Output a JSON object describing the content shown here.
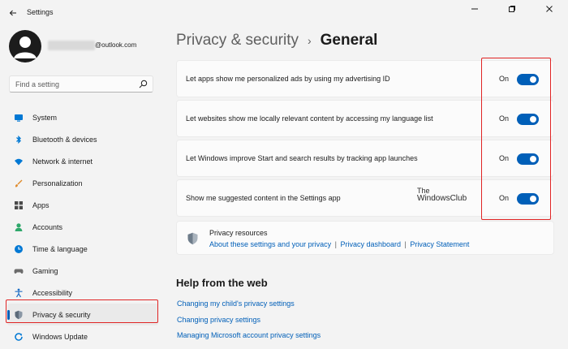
{
  "app": {
    "title": "Settings"
  },
  "profile": {
    "email": "@outlook.com"
  },
  "search": {
    "placeholder": "Find a setting"
  },
  "sidebar": {
    "items": [
      {
        "label": "System",
        "icon": "monitor-icon",
        "color": "#0078d4"
      },
      {
        "label": "Bluetooth & devices",
        "icon": "bluetooth-icon",
        "color": "#0078d4"
      },
      {
        "label": "Network & internet",
        "icon": "wifi-icon",
        "color": "#0078d4"
      },
      {
        "label": "Personalization",
        "icon": "brush-icon",
        "color": "#e08b2c"
      },
      {
        "label": "Apps",
        "icon": "apps-icon",
        "color": "#4a4a4a"
      },
      {
        "label": "Accounts",
        "icon": "person-icon",
        "color": "#2fa86b"
      },
      {
        "label": "Time & language",
        "icon": "globe-clock-icon",
        "color": "#0078d4"
      },
      {
        "label": "Gaming",
        "icon": "gamepad-icon",
        "color": "#6b6b6b"
      },
      {
        "label": "Accessibility",
        "icon": "accessibility-icon",
        "color": "#1f6fc5"
      },
      {
        "label": "Privacy & security",
        "icon": "shield-icon",
        "color": "#6b7b8c",
        "selected": true
      },
      {
        "label": "Windows Update",
        "icon": "update-icon",
        "color": "#0078d4"
      }
    ]
  },
  "breadcrumb": {
    "parent": "Privacy & security",
    "separator": "›",
    "current": "General"
  },
  "settings": [
    {
      "label": "Let apps show me personalized ads by using my advertising ID",
      "state": "On"
    },
    {
      "label": "Let websites show me locally relevant content by accessing my language list",
      "state": "On"
    },
    {
      "label": "Let Windows improve Start and search results by tracking app launches",
      "state": "On"
    },
    {
      "label": "Show me suggested content in the Settings app",
      "state": "On"
    }
  ],
  "watermark": {
    "line1": "The",
    "line2": "WindowsClub"
  },
  "resources": {
    "title": "Privacy resources",
    "links": [
      "About these settings and your privacy",
      "Privacy dashboard",
      "Privacy Statement"
    ],
    "separator": "|"
  },
  "help": {
    "heading": "Help from the web",
    "links": [
      "Changing my child's privacy settings",
      "Changing privacy settings",
      "Managing Microsoft account privacy settings"
    ]
  },
  "colors": {
    "accent": "#005fb8",
    "highlight": "#e02424",
    "background": "#f3f3f3",
    "card": "#fbfbfb"
  }
}
